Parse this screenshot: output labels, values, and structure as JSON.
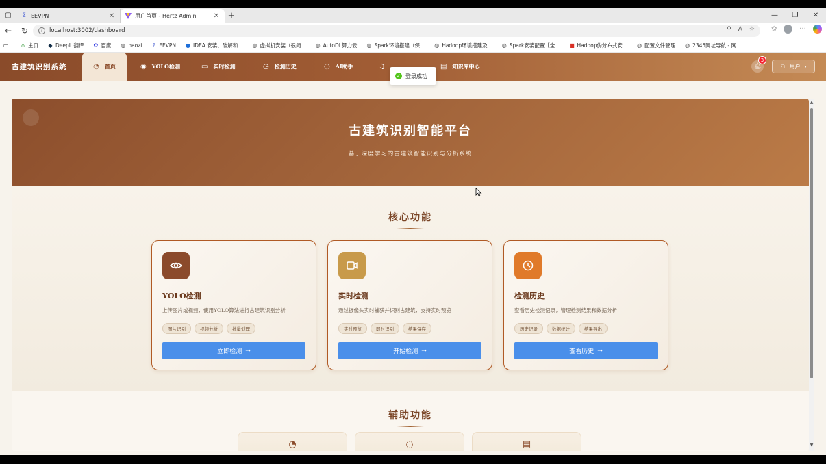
{
  "browser": {
    "tabs": [
      {
        "title": "EEVPN",
        "icon": "sigma-icon",
        "active": false
      },
      {
        "title": "用户首页 - Hertz Admin",
        "icon": "vite-icon",
        "active": true
      }
    ],
    "url": "localhost:3002/dashboard",
    "bookmarks": [
      "主页",
      "DeepL 翻译",
      "百度",
      "haozi",
      "EEVPN",
      "IDEA 安装、破解和...",
      "虚拟机安装（很简...",
      "AutoDL算力云",
      "Spark环境搭建（保...",
      "Hadoop环境搭建及...",
      "Spark安装配置【全...",
      "Hadoop伪分布式安...",
      "配置文件管理",
      "2345网址导航 - 网..."
    ]
  },
  "app": {
    "brand": "古建筑识别系统",
    "nav": [
      {
        "label": "首页",
        "icon": "dashboard-icon"
      },
      {
        "label": "YOLO检测",
        "icon": "eye-icon"
      },
      {
        "label": "实时检测",
        "icon": "video-icon"
      },
      {
        "label": "检测历史",
        "icon": "history-icon"
      },
      {
        "label": "AI助手",
        "icon": "chat-icon"
      },
      {
        "label": "知识库中心",
        "icon": "book-icon"
      }
    ],
    "toast": "登录成功",
    "notification_count": "3",
    "user_label": "用户"
  },
  "hero": {
    "title": "古建筑识别智能平台",
    "subtitle": "基于深度学习的古建筑智能识别与分析系统"
  },
  "core": {
    "title": "核心功能",
    "cards": [
      {
        "title": "YOLO检测",
        "desc": "上传图片或视频，使用YOLO算法进行古建筑识别分析",
        "tags": [
          "图片识别",
          "视频分析",
          "批量处理"
        ],
        "button": "立即检测",
        "icon": "eye-icon",
        "icon_color": "#8b4a2b"
      },
      {
        "title": "实时检测",
        "desc": "通过摄像头实时捕获并识别古建筑，支持实时预览",
        "tags": [
          "实时预览",
          "即时识别",
          "结果保存"
        ],
        "button": "开始检测",
        "icon": "video-icon",
        "icon_color": "#c89a4a"
      },
      {
        "title": "检测历史",
        "desc": "查看历史检测记录，管理检测结果和数据分析",
        "tags": [
          "历史记录",
          "数据统计",
          "结果导出"
        ],
        "button": "查看历史",
        "icon": "history-icon",
        "icon_color": "#e07a2a"
      }
    ]
  },
  "aux": {
    "title": "辅助功能",
    "cards": [
      {
        "icon": "dashboard-icon"
      },
      {
        "icon": "chat-icon"
      },
      {
        "icon": "book-icon"
      }
    ]
  },
  "colors": {
    "nav_gradient_start": "#8a4b2a",
    "nav_gradient_end": "#c48a55",
    "button_blue": "#4a8fea",
    "card_border": "#b05a25"
  }
}
